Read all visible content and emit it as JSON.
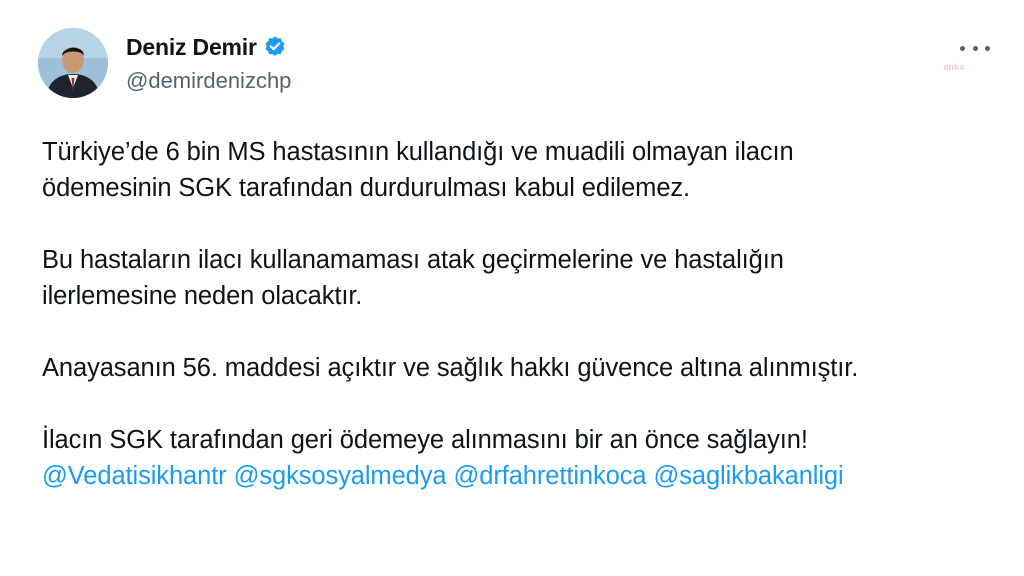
{
  "author": {
    "display_name": "Deniz Demir",
    "handle": "@demirdenizchp",
    "verified": true,
    "avatar_icon": "profile-photo"
  },
  "watermark": "anka",
  "colors": {
    "mention": "#1d9bf0",
    "verified_badge": "#1d9bf0",
    "text": "#0f1419",
    "secondary_text": "#536471"
  },
  "tweet": {
    "paragraphs": [
      {
        "lines": [
          "Türkiye’de 6 bin MS hastasının kullandığı ve muadili olmayan ilacın",
          "ödemesinin SGK tarafından durdurulması kabul edilemez."
        ]
      },
      {
        "lines": [
          "Bu hastaların ilacı kullanamaması atak geçirmelerine ve hastalığın",
          "ilerlemesine neden olacaktır."
        ]
      },
      {
        "lines": [
          "Anayasanın 56. maddesi açıktır ve sağlık hakkı güvence altına alınmıştır."
        ]
      },
      {
        "lines": [
          "İlacın SGK tarafından geri ödemeye alınmasını bir an önce sağlayın!"
        ]
      }
    ],
    "mentions": [
      "@Vedatisikhantr",
      "@sgksosyalmedya",
      "@drfahrettinkoca",
      "@saglikbakanligi"
    ]
  }
}
